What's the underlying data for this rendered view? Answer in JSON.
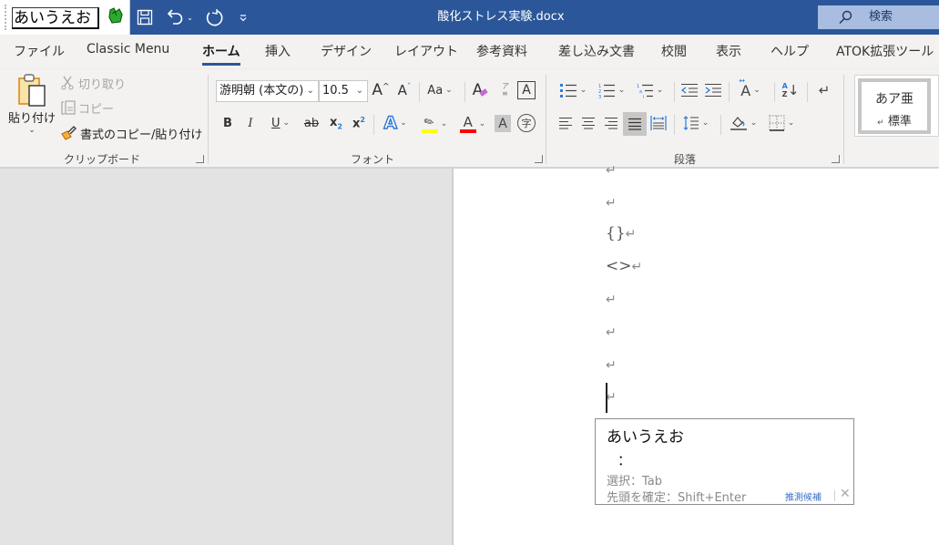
{
  "ime": {
    "composition": "あいうえお",
    "icon": "atok-logo-icon"
  },
  "titlebar": {
    "document_title": "酸化ストレス実験.docx",
    "quick_access": [
      {
        "name": "save-icon"
      },
      {
        "name": "undo-icon"
      },
      {
        "name": "redo-icon"
      },
      {
        "name": "customize-quick-access-icon"
      }
    ],
    "search_label": "検索"
  },
  "tabs": [
    {
      "label": "ファイル"
    },
    {
      "label": "Classic Menu"
    },
    {
      "label": "ホーム",
      "active": true
    },
    {
      "label": "挿入"
    },
    {
      "label": "デザイン"
    },
    {
      "label": "レイアウト"
    },
    {
      "label": "参考資料"
    },
    {
      "label": "差し込み文書"
    },
    {
      "label": "校閲"
    },
    {
      "label": "表示"
    },
    {
      "label": "ヘルプ"
    },
    {
      "label": "ATOK拡張ツール"
    }
  ],
  "ribbon": {
    "clipboard": {
      "label": "クリップボード",
      "paste": "貼り付け",
      "cut": "切り取り",
      "copy": "コピー",
      "format_painter": "書式のコピー/貼り付け"
    },
    "font": {
      "label": "フォント",
      "font_name": "游明朝 (本文の)",
      "font_size": "10.5",
      "change_case": "Aa",
      "colors": {
        "highlight": "#ffff00",
        "font_color": "#ff0000",
        "text_effect": "#2e75d6"
      }
    },
    "paragraph": {
      "label": "段落",
      "justify_active": true
    },
    "styles": {
      "sample": "あア亜",
      "name": "標準"
    }
  },
  "document": {
    "paragraphs": [
      {
        "text": ""
      },
      {
        "text": ""
      },
      {
        "text": "{}"
      },
      {
        "text": "<>"
      },
      {
        "text": ""
      },
      {
        "text": ""
      },
      {
        "text": ""
      },
      {
        "text": ""
      }
    ],
    "paragraph_mark": "↵"
  },
  "prediction_popup": {
    "candidate": "あいうえお",
    "colon": "：",
    "hint_select": "選択：Tab",
    "hint_confirm": "先頭を確定：Shift+Enter",
    "link": "推測候補",
    "close": "✕"
  }
}
